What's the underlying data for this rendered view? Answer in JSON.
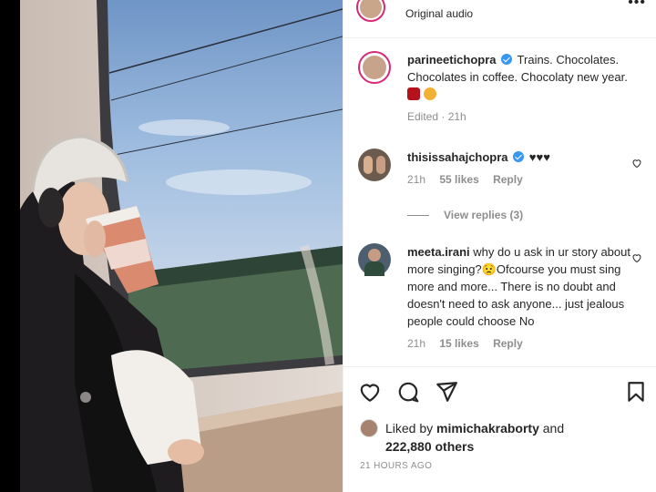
{
  "post": {
    "header": {
      "audio_label": "Original audio",
      "more_icon": "more-horizontal-icon"
    },
    "caption": {
      "username": "parineetichopra",
      "verified": true,
      "text": "Trains. Chocolates. Chocolates in coffee. Chocolaty new year.",
      "emojis": [
        "chocolate-bar-emoji",
        "face-with-hearts-emoji"
      ],
      "edited_label": "Edited",
      "time": "21h"
    },
    "comments": [
      {
        "username": "thisissahajchopra",
        "verified": true,
        "text": "♥♥♥",
        "time": "21h",
        "likes": "55 likes",
        "reply_label": "Reply",
        "view_replies": "View replies (3)"
      },
      {
        "username": "meeta.irani",
        "verified": false,
        "text": "why do u ask in ur story about more singing?😟Ofcourse you must sing more and more... There is no doubt and doesn't need to ask anyone... just jealous people could choose No",
        "time": "21h",
        "likes": "15 likes",
        "reply_label": "Reply"
      }
    ],
    "actions": {
      "like_icon": "heart-icon",
      "comment_icon": "comment-icon",
      "share_icon": "send-icon",
      "save_icon": "bookmark-icon"
    },
    "liked_by": {
      "prefix": "Liked by",
      "username": "mimichakraborty",
      "connector": "and",
      "others": "222,880 others"
    },
    "timestamp": "21 HOURS AGO"
  },
  "colors": {
    "verified": "#3897f0",
    "muted": "#8e8e8e",
    "text": "#262626",
    "story_ring": "#d62976"
  }
}
